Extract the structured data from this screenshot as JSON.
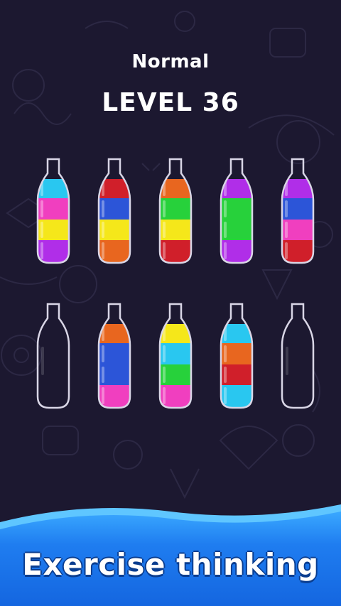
{
  "header": {
    "difficulty": "Normal",
    "level": "LEVEL 36"
  },
  "colors": {
    "background": "#1c1830",
    "cyan": "#29c7f0",
    "pink": "#f03fbf",
    "yellow": "#f5e71a",
    "purple": "#b02ee8",
    "red": "#d01f2a",
    "blue": "#2c55d8",
    "orange": "#e8661f",
    "green": "#27d13b",
    "banner_blue": "#1569e0",
    "banner_light": "#2fa4ff"
  },
  "bottles": [
    {
      "row": 1,
      "layers_top_to_bottom": [
        "cyan",
        "pink",
        "yellow",
        "purple"
      ]
    },
    {
      "row": 1,
      "layers_top_to_bottom": [
        "red",
        "blue",
        "yellow",
        "orange"
      ]
    },
    {
      "row": 1,
      "layers_top_to_bottom": [
        "orange",
        "green",
        "yellow",
        "red"
      ]
    },
    {
      "row": 1,
      "layers_top_to_bottom": [
        "purple",
        "green",
        "green",
        "purple"
      ]
    },
    {
      "row": 1,
      "layers_top_to_bottom": [
        "purple",
        "blue",
        "pink",
        "red"
      ]
    },
    {
      "row": 2,
      "layers_top_to_bottom": []
    },
    {
      "row": 2,
      "layers_top_to_bottom": [
        "orange",
        "blue",
        "blue",
        "pink"
      ]
    },
    {
      "row": 2,
      "layers_top_to_bottom": [
        "yellow",
        "cyan",
        "green",
        "pink"
      ]
    },
    {
      "row": 2,
      "layers_top_to_bottom": [
        "cyan",
        "orange",
        "red",
        "cyan"
      ]
    },
    {
      "row": 2,
      "layers_top_to_bottom": []
    }
  ],
  "footer": {
    "slogan": "Exercise thinking"
  }
}
